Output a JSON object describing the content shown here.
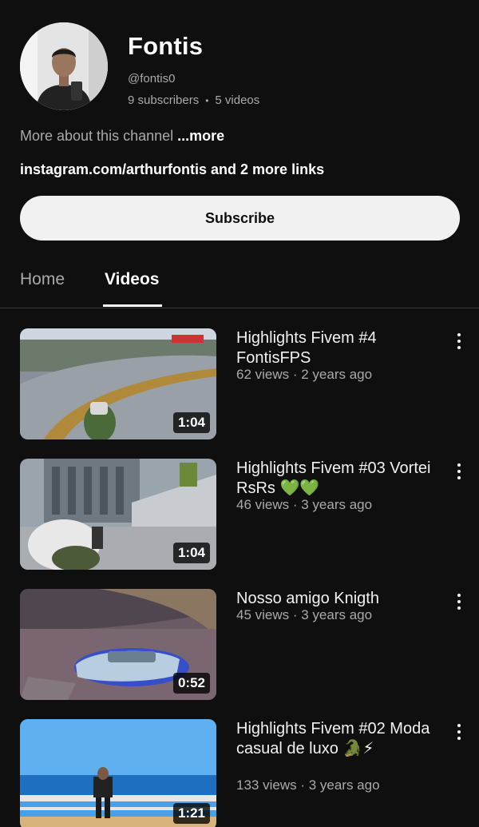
{
  "channel": {
    "name": "Fontis",
    "handle": "@fontis0",
    "subscribers": "9 subscribers",
    "videos_count": "5 videos",
    "stats_separator": "•",
    "about_text": "More about this channel",
    "about_more": "...more",
    "links": "instagram.com/arthurfontis and 2 more links",
    "subscribe_label": "Subscribe"
  },
  "tabs": [
    {
      "label": "Home",
      "active": false
    },
    {
      "label": "Videos",
      "active": true
    }
  ],
  "videos": [
    {
      "title": "Highlights Fivem #4 FontisFPS",
      "meta": "62 views · 2 years ago",
      "duration": "1:04"
    },
    {
      "title": "Highlights Fivem #03 Vortei RsRs 💚💚",
      "meta": "46 views · 3 years ago",
      "duration": "1:04"
    },
    {
      "title": "Nosso amigo Knigth",
      "meta": "45 views · 3 years ago",
      "duration": "0:52"
    },
    {
      "title": "Highlights Fivem #02 Moda casual de luxo 🐊⚡",
      "meta": "133 views · 3 years ago",
      "duration": "1:21"
    }
  ],
  "icons": {
    "more": "more-vertical-icon"
  }
}
